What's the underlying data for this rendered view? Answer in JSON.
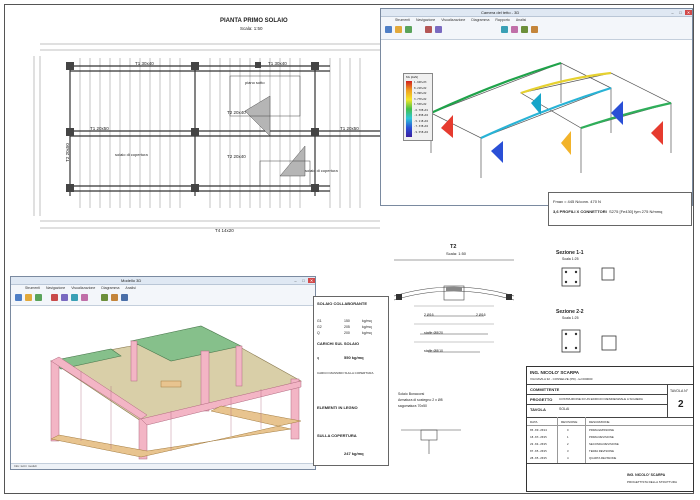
{
  "plan": {
    "title": "PIANTA PRIMO SOLAIO",
    "scale": "Scala: 1:50",
    "beams": [
      "T1 30x40",
      "T1 30x40",
      "T1 20x50",
      "T1 20x50",
      "T2 20x40",
      "T2 20x40",
      "T4 14x20",
      "T2 20x50"
    ],
    "labels": [
      "piano sotto",
      "solaio di copertura",
      "solaio di copertura"
    ],
    "columns": [
      "p01",
      "p02",
      "p03",
      "p04",
      "p05",
      "p06",
      "p07",
      "p08",
      "p09",
      "p10"
    ]
  },
  "fem_window": {
    "title": "Camera del tetto - 3D",
    "ribbon_tabs": [
      "Strumenti",
      "Navigazione",
      "Visualizzazione",
      "Diagramma",
      "Rapporto",
      "Analisi"
    ],
    "legend_title": "Mx [daN]",
    "legend_values": [
      "1.04E+03",
      "8.21E+02",
      "5.99E+02",
      "3.77E+02",
      "1.55E+02",
      "-6.70E+01",
      "-2.89E+02",
      "-5.11E+02",
      "-7.33E+02",
      "-9.55E+02"
    ]
  },
  "model_window": {
    "title": "Modello 3D",
    "ribbon_tabs": [
      "Strumenti",
      "Navigazione",
      "Visualizzazione",
      "Diagramma",
      "Analisi"
    ],
    "status": "Info: tutti i moduli"
  },
  "calc_panel": {
    "headings": [
      "SOLAIO COLLABORANTE",
      "CARICHI SUL SOLAIO",
      "ELEMENTI IN LEGNO",
      "SULLA COPERTURA"
    ],
    "rows1": [
      [
        "G1",
        "150",
        "kg/mq"
      ],
      [
        "G2",
        "205",
        "kg/mq"
      ],
      [
        "Q",
        "200",
        "kg/mq"
      ]
    ],
    "total1_label": "q",
    "total1_value": "550 kg/mq",
    "total2_value": "247 kg/mq",
    "footnote": "CARICO MASSIMO SULLA COPERTURA"
  },
  "connector_panel": {
    "line1": "Fmax = 445 N/conn. 470 N",
    "line2": "3,6 PROFILI X CONNETTORI",
    "line3": "S275 [Fe430] fym 275 N/mmq"
  },
  "section": {
    "title": "T2",
    "scale": "Scala: 1:50",
    "notes": [
      "2 Ø16",
      "2 Ø16",
      "staffe Ø8/20",
      "staffe Ø8/10"
    ],
    "pattern_notes": [
      "Solaio Bonacorsi",
      "Armatura di sostegno 2 x Ø8",
      "sagomatura 70x50"
    ]
  },
  "sections_side": [
    {
      "title": "Sezione 1-1",
      "scale": "Scala 1:25"
    },
    {
      "title": "Sezione 2-2",
      "scale": "Scala 1:25"
    }
  ],
  "title_block": {
    "engineer": "ING. NICOLO' SCARPA",
    "engineer_sub": "VIA DAVILA 32 - CONSELVE (PD) - tel 000000",
    "committente_label": "COMMITTENTE",
    "progetto_label": "PROGETTO",
    "progetto_value": "COSTRUZIONE DI UN EDIFICIO RESIDENZIALE A SCHIERA",
    "tavola_label": "TAVOLA",
    "tavola_value": "SOLAI",
    "tavola_n_label": "TAVOLA N°",
    "tavola_n": "2",
    "rev_headers": [
      "DATA",
      "REVISIONE",
      "DESCRIZIONE"
    ],
    "revisions": [
      [
        "05-09-2014",
        "0",
        "PRIMA EMISSIONE"
      ],
      [
        "18-03-2015",
        "1",
        "PRIMA REVISIONE"
      ],
      [
        "22-04-2015",
        "2",
        "SECONDA REVISIONE"
      ],
      [
        "07-05-2015",
        "3",
        "TERZA REVISIONE"
      ],
      [
        "28-05-2015",
        "4",
        "QUARTA REVISIONE"
      ]
    ],
    "signature_name": "ING. NICOLO' SCARPA",
    "signature_role": "PROGETTISTA DELLA STRUTTURA"
  },
  "colors": {
    "drawing_line": "#3a3a3a",
    "ribbon_bg": "#f3f6fa",
    "frame_pink": "#f3b5c5",
    "frame_wood": "#e8c48f",
    "floor_slab": "#d9cfa8",
    "roof_slab": "#86c08b"
  }
}
